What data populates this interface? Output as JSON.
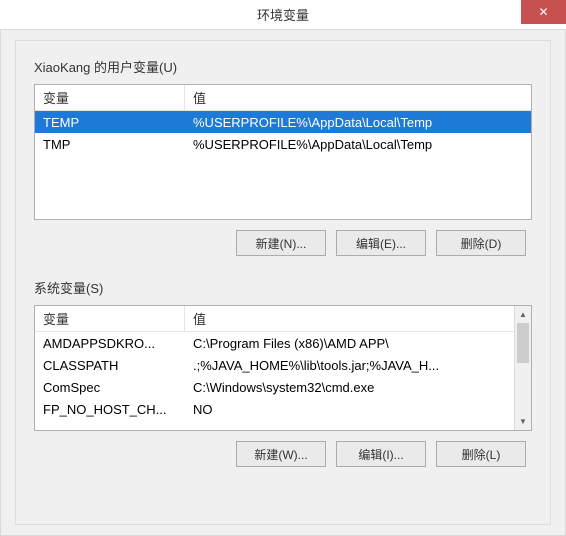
{
  "window": {
    "title": "环境变量"
  },
  "user_section": {
    "label": "XiaoKang 的用户变量(U)",
    "columns": {
      "name": "变量",
      "value": "值"
    },
    "rows": [
      {
        "name": "TEMP",
        "value": "%USERPROFILE%\\AppData\\Local\\Temp",
        "selected": true
      },
      {
        "name": "TMP",
        "value": "%USERPROFILE%\\AppData\\Local\\Temp",
        "selected": false
      }
    ],
    "buttons": {
      "new": "新建(N)...",
      "edit": "编辑(E)...",
      "delete": "删除(D)"
    }
  },
  "system_section": {
    "label": "系统变量(S)",
    "columns": {
      "name": "变量",
      "value": "值"
    },
    "rows": [
      {
        "name": "AMDAPPSDKRO...",
        "value": "C:\\Program Files (x86)\\AMD APP\\"
      },
      {
        "name": "CLASSPATH",
        "value": ".;%JAVA_HOME%\\lib\\tools.jar;%JAVA_H..."
      },
      {
        "name": "ComSpec",
        "value": "C:\\Windows\\system32\\cmd.exe"
      },
      {
        "name": "FP_NO_HOST_CH...",
        "value": "NO"
      }
    ],
    "buttons": {
      "new": "新建(W)...",
      "edit": "编辑(I)...",
      "delete": "删除(L)"
    }
  }
}
